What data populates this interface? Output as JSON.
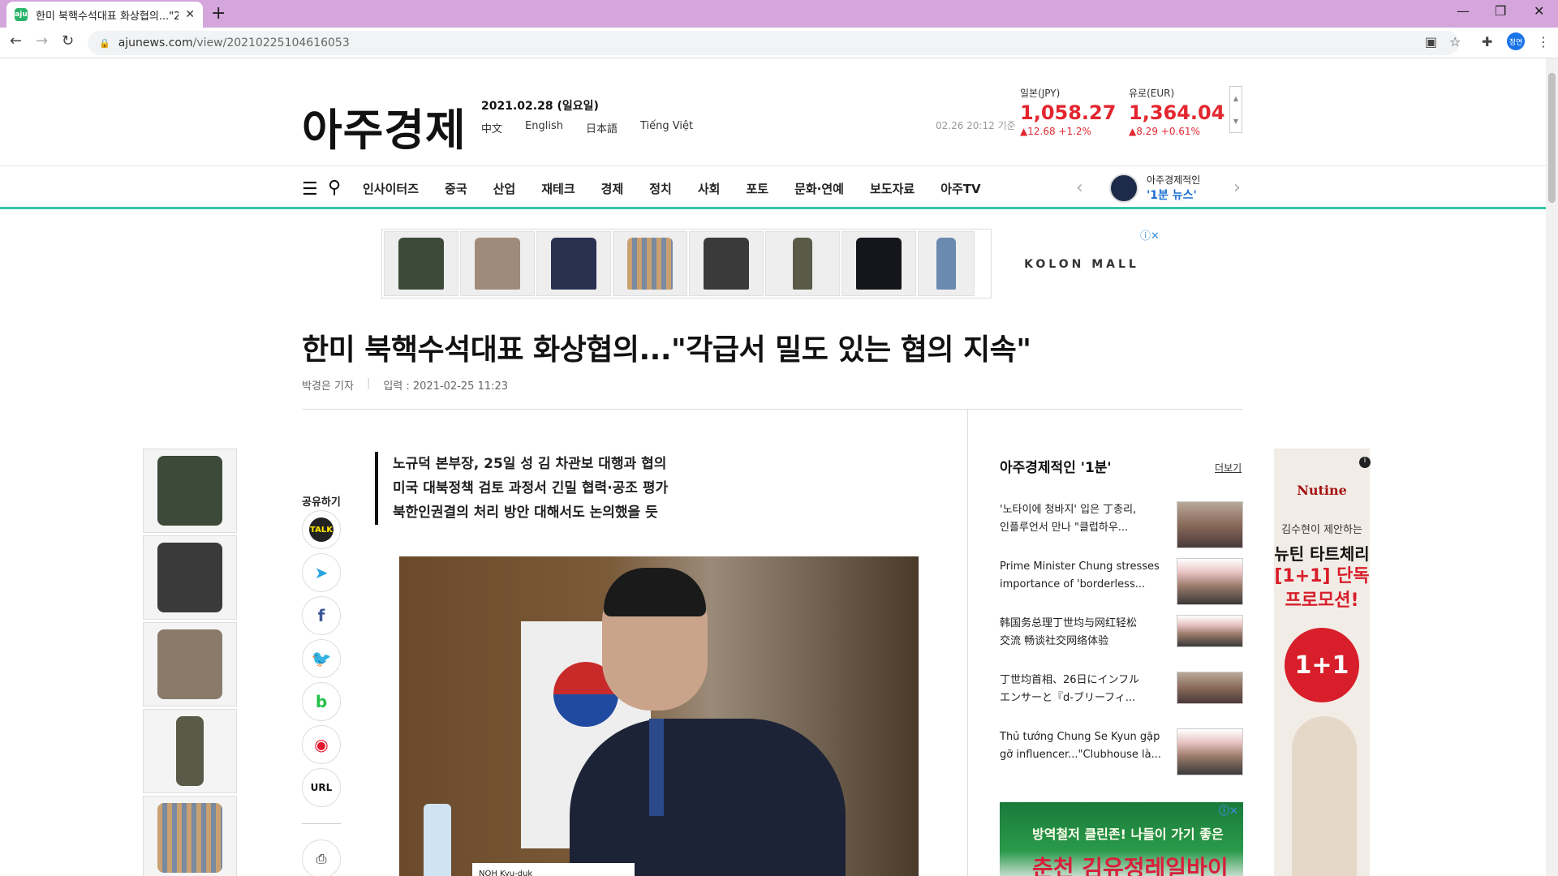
{
  "browser": {
    "tab_title": "한미 북핵수석대표 화상협의...\"2",
    "tab_favicon": "aju-favicon-icon",
    "url_domain": "ajunews.com",
    "url_path": "/view/20210225104616053",
    "profile_label": "정연"
  },
  "header": {
    "logo": "아주경제",
    "date": "2021.02.28 (일요일)",
    "languages": [
      "中文",
      "English",
      "日本語",
      "Tiếng Việt"
    ],
    "rate_time": "02.26 20:12 기준",
    "rates": [
      {
        "name": "일본(JPY)",
        "value": "1,058.27",
        "change": "▲12.68  +1.2%"
      },
      {
        "name": "유로(EUR)",
        "value": "1,364.04",
        "change": "▲8.29  +0.61%"
      }
    ]
  },
  "nav": {
    "items": [
      "인사이터즈",
      "중국",
      "산업",
      "재테크",
      "경제",
      "정치",
      "사회",
      "포토",
      "문화·연예",
      "보도자료",
      "아주TV"
    ],
    "promo_line1": "아주경제적인",
    "promo_line2": "'1분 뉴스'"
  },
  "ads": {
    "kolon_label": "KOLON MALL",
    "right_ad_line1": "방역철저 클린존! 나들이 가기 좋은",
    "right_ad_line2": "춘천 김유정레일바이크",
    "far_brand": "Nutine",
    "far_sub": "김수현이 제안하는",
    "far_big1": "뉴틴 타트체리",
    "far_big2a": "[1+1] 단독",
    "far_big2b": "프로모션!",
    "far_circle": "1+1"
  },
  "article": {
    "headline": "한미 북핵수석대표 화상협의...\"각급서 밀도 있는 협의 지속\"",
    "reporter": "박경은 기자",
    "published": "입력 : 2021-02-25 11:23",
    "summary": [
      "노규덕 본부장, 25일 성 김 차관보 대행과 협의",
      "미국 대북정책 검토 과정서 긴밀 협력·공조 평가",
      "북한인권결의 처리 방안 대해서도 논의했을 듯"
    ],
    "photo_caption_plate": "NOH Kyu-duk"
  },
  "share": {
    "label": "공유하기",
    "buttons": [
      "TALK",
      "telegram",
      "f",
      "twitter",
      "band",
      "weibo",
      "URL"
    ]
  },
  "sidebar": {
    "title": "아주경제적인 '1분'",
    "more": "더보기",
    "news": [
      {
        "line1": "'노타이에 청바지' 입은 丁총리,",
        "line2": "인플루언서 만나 \"클럽하우..."
      },
      {
        "line1": "Prime Minister Chung stresses",
        "line2": "importance of 'borderless..."
      },
      {
        "line1": "韩国务总理丁世均与网红轻松",
        "line2": "交流 畅谈社交网络体验"
      },
      {
        "line1": "丁世均首相、26日にインフル",
        "line2": "エンサーと『d-ブリーフィ..."
      },
      {
        "line1": "Thủ tướng Chung Se Kyun gặp",
        "line2": "gỡ influencer...\"Clubhouse là..."
      }
    ]
  },
  "colors": {
    "tabbar": "#d4a6dc",
    "accent_green": "#35c6a6",
    "rate_red": "#e3262f",
    "promo_blue": "#1c6fd3"
  }
}
